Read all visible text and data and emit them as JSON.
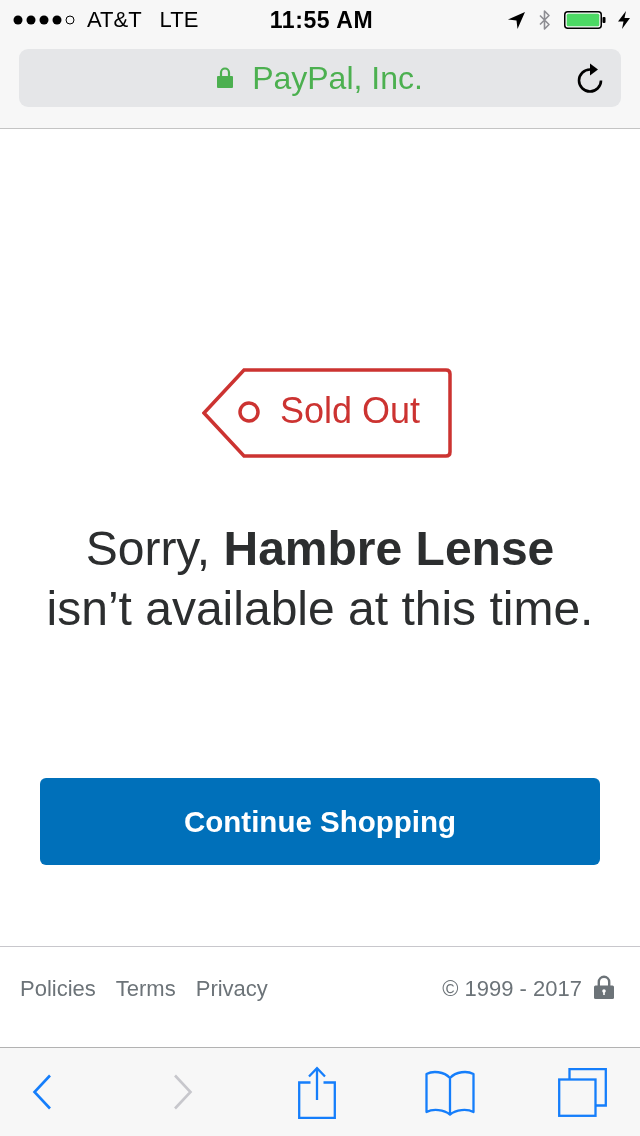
{
  "status_bar": {
    "carrier": "AT&T",
    "network": "LTE",
    "time": "11:55 AM",
    "charging": true
  },
  "address_bar": {
    "site": "PayPal, Inc.",
    "secure": true
  },
  "tag": {
    "label": "Sold Out"
  },
  "message": "Sorry, **Hambre Lense**\nisn’t available at this time.",
  "primary_button": {
    "label": "Continue Shopping"
  },
  "footer": {
    "links": [
      "Policies",
      "Terms",
      "Privacy"
    ],
    "copyright": "© 1999 - 2017"
  },
  "toolbar": {
    "items": [
      {
        "kind": "back",
        "disabled": false
      },
      {
        "kind": "forward",
        "disabled": true
      },
      {
        "kind": "share",
        "disabled": false
      },
      {
        "kind": "bookmarks",
        "disabled": false
      },
      {
        "kind": "tabs",
        "disabled": false
      }
    ]
  }
}
